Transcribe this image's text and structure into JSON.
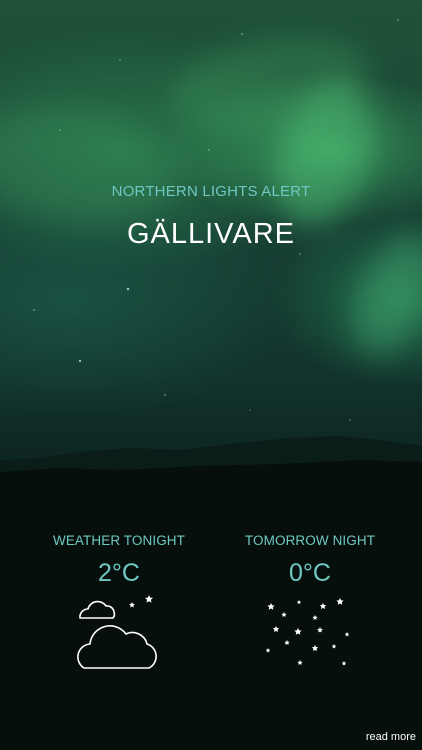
{
  "alert": {
    "label": "NORTHERN LIGHTS ALERT",
    "location": "GÄLLIVARE"
  },
  "forecast": [
    {
      "title": "WEATHER TONIGHT",
      "temperature": "2°C",
      "icon": "cloudy-night-icon"
    },
    {
      "title": "TOMORROW NIGHT",
      "temperature": "0°C",
      "icon": "clear-starry-night-icon"
    }
  ],
  "footer": {
    "read_more": "read more"
  },
  "colors": {
    "accent": "#6fc8c2",
    "text": "#ffffff",
    "ground": "#050e0b"
  }
}
